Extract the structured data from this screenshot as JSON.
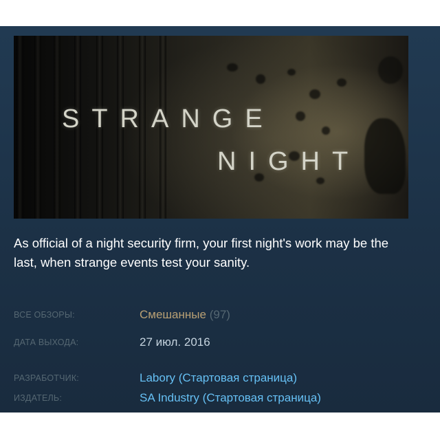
{
  "game": {
    "title_line1": "STRANGE",
    "title_line2": "NIGHT",
    "description": "As official of a night security firm, your first night's work may be the last, when strange events test your sanity."
  },
  "reviews": {
    "label": "ВСЕ ОБЗОРЫ:",
    "summary": "Смешанные",
    "count": "(97)"
  },
  "release": {
    "label": "ДАТА ВЫХОДА:",
    "date": "27 июл. 2016"
  },
  "developer": {
    "label": "РАЗРАБОТЧИК:",
    "name": "Labory",
    "open_paren": "(",
    "homepage": "Стартовая страница",
    "close_paren": ")"
  },
  "publisher": {
    "label": "ИЗДАТЕЛЬ:",
    "name": "SA Industry",
    "open_paren": "(",
    "homepage": "Стартовая страница",
    "close_paren": ")"
  },
  "colors": {
    "panel_bg": "#1c3146",
    "label": "#556772",
    "mixed": "#b9a074",
    "link": "#66c0f4",
    "text": "#c6d4df"
  }
}
